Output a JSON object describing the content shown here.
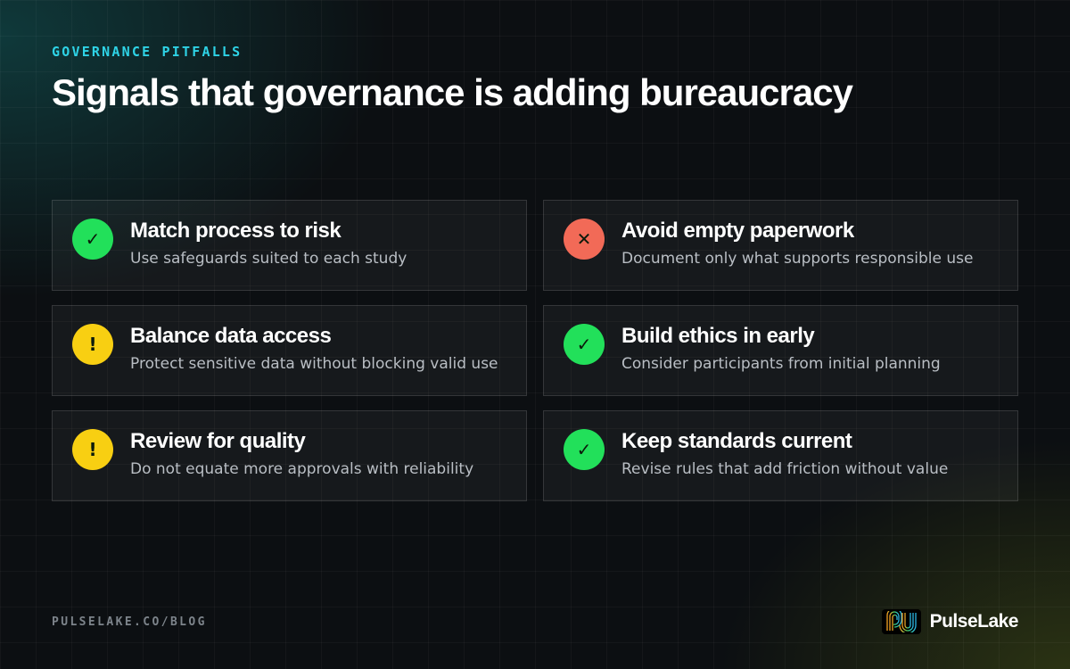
{
  "header": {
    "eyebrow": "GOVERNANCE PITFALLS",
    "title": "Signals that governance is adding bureaucracy"
  },
  "colors": {
    "accent": "#2ed3e6",
    "ok": "#22e05a",
    "bad": "#f26a57",
    "warn": "#f8cf12"
  },
  "cards": [
    {
      "status": "ok",
      "icon": "check-icon",
      "glyph": "✓",
      "title": "Match process to risk",
      "description": "Use safeguards suited to each study"
    },
    {
      "status": "bad",
      "icon": "x-icon",
      "glyph": "✕",
      "title": "Avoid empty paperwork",
      "description": "Document only what supports responsible use"
    },
    {
      "status": "warn",
      "icon": "exclamation-icon",
      "glyph": "!",
      "title": "Balance data access",
      "description": "Protect sensitive data without blocking valid use"
    },
    {
      "status": "ok",
      "icon": "check-icon",
      "glyph": "✓",
      "title": "Build ethics in early",
      "description": "Consider participants from initial planning"
    },
    {
      "status": "warn",
      "icon": "exclamation-icon",
      "glyph": "!",
      "title": "Review for quality",
      "description": "Do not equate more approvals with reliability"
    },
    {
      "status": "ok",
      "icon": "check-icon",
      "glyph": "✓",
      "title": "Keep standards current",
      "description": "Revise rules that add friction without value"
    }
  ],
  "footer": {
    "url": "PULSELAKE.CO/BLOG",
    "brand_name": "PulseLake",
    "brand_icon": "pulselake-logo-icon"
  }
}
